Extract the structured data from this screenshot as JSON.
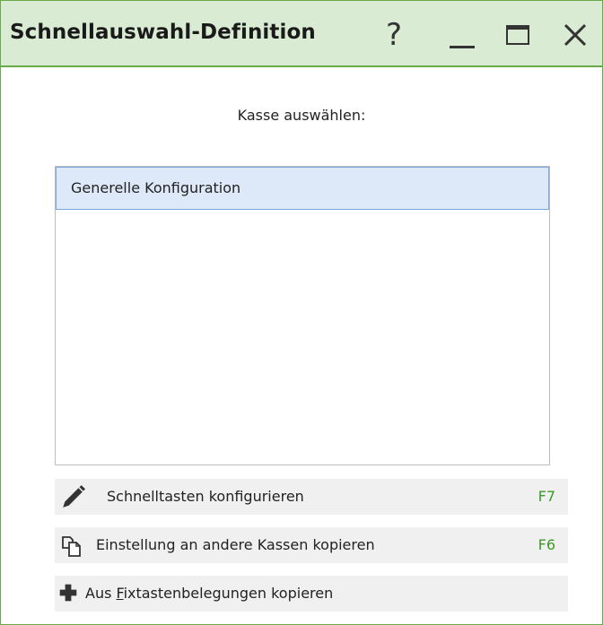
{
  "window": {
    "title": "Schnellauswahl-Definition",
    "controls": {
      "help": "?",
      "minimize": "minimize",
      "maximize": "maximize",
      "close": "close"
    }
  },
  "main": {
    "prompt": "Kasse auswählen:",
    "list": {
      "items": [
        {
          "label": "Generelle Konfiguration",
          "selected": true
        }
      ]
    },
    "actions": [
      {
        "icon": "pencil-icon",
        "label": "Schnelltasten konfigurieren",
        "shortcut": "F7"
      },
      {
        "icon": "copy-icon",
        "label": "Einstellung an andere Kassen kopieren",
        "shortcut": "F6"
      },
      {
        "icon": "plus-icon",
        "label_prefix": "Aus ",
        "label_mnemonic": "F",
        "label_rest": "ixtastenbelegungen kopieren"
      }
    ]
  },
  "colors": {
    "titlebar_bg": "#d9ebd3",
    "border_green": "#6aaa4a",
    "selection_bg": "#dde9f8",
    "selection_border": "#7ba8de",
    "shortcut_green": "#3a9a28"
  }
}
